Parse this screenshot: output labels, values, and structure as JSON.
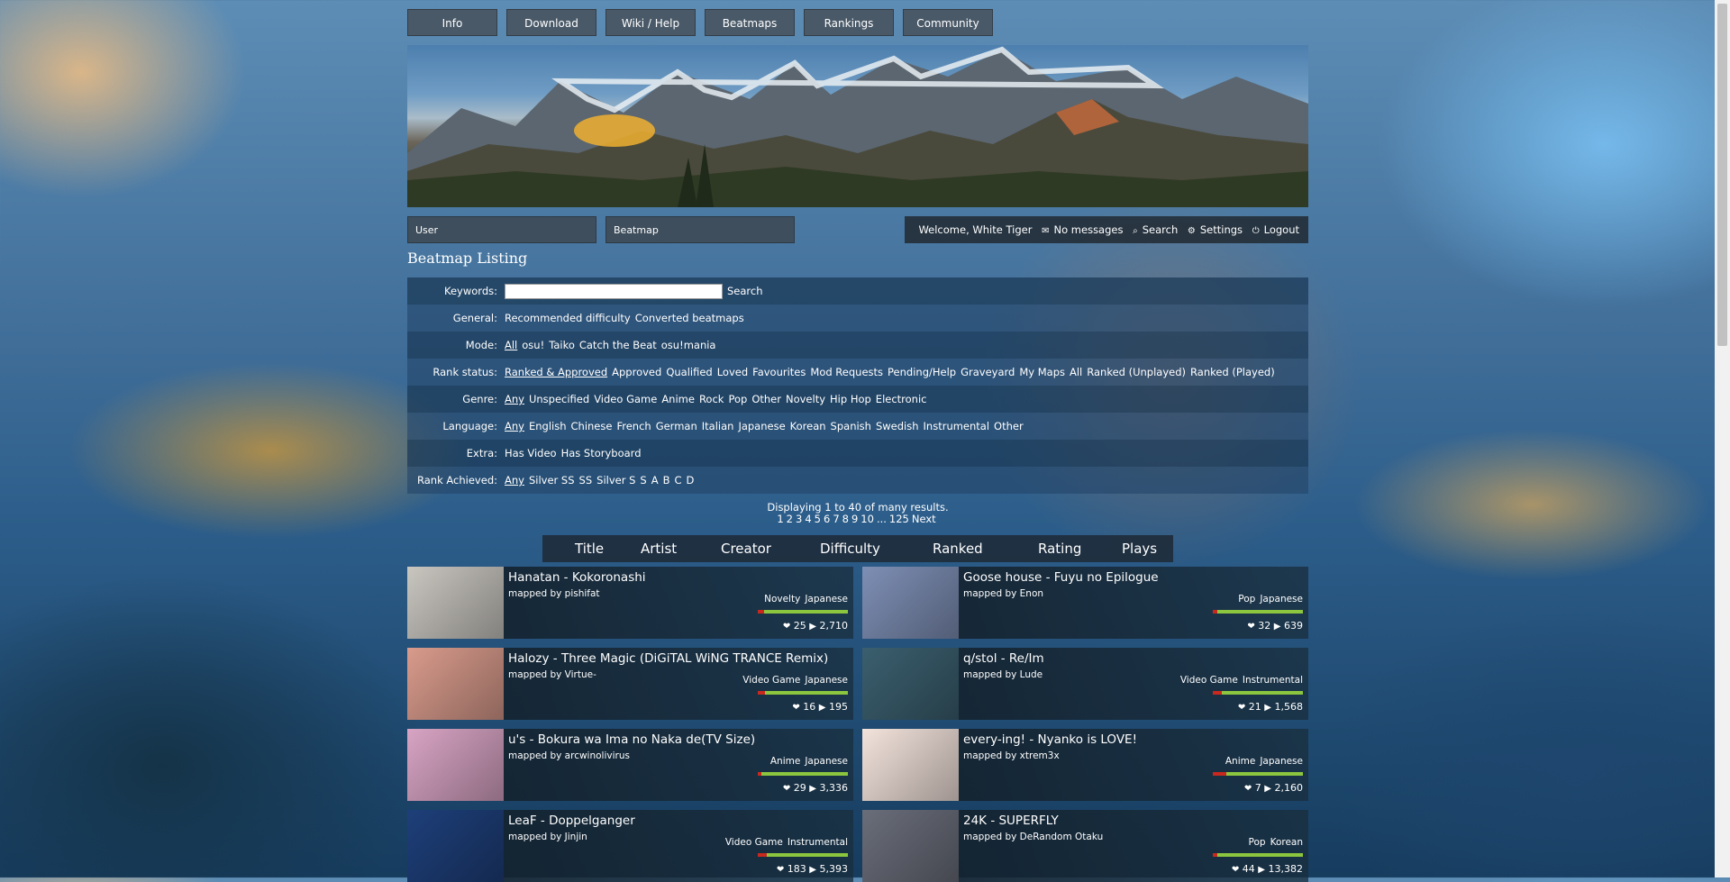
{
  "nav": [
    "Info",
    "Download",
    "Wiki / Help",
    "Beatmaps",
    "Rankings",
    "Community"
  ],
  "quicksearch": {
    "user_placeholder": "User",
    "beatmap_placeholder": "Beatmap"
  },
  "userbar": {
    "welcome": "Welcome, White Tiger",
    "messages": "No messages",
    "search": "Search",
    "settings": "Settings",
    "logout": "Logout"
  },
  "page_title": "Beatmap Listing",
  "filters": {
    "keywords": {
      "label": "Keywords:",
      "search_label": "Search"
    },
    "general": {
      "label": "General:",
      "options": [
        "Recommended difficulty",
        "Converted beatmaps"
      ]
    },
    "mode": {
      "label": "Mode:",
      "options": [
        "All",
        "osu!",
        "Taiko",
        "Catch the Beat",
        "osu!mania"
      ]
    },
    "rank_status": {
      "label": "Rank status:",
      "options": [
        "Ranked & Approved",
        "Approved",
        "Qualified",
        "Loved",
        "Favourites",
        "Mod Requests",
        "Pending/Help",
        "Graveyard",
        "My Maps",
        "All",
        "Ranked (Unplayed)",
        "Ranked (Played)"
      ]
    },
    "genre": {
      "label": "Genre:",
      "options": [
        "Any",
        "Unspecified",
        "Video Game",
        "Anime",
        "Rock",
        "Pop",
        "Other",
        "Novelty",
        "Hip Hop",
        "Electronic"
      ]
    },
    "language": {
      "label": "Language:",
      "options": [
        "Any",
        "English",
        "Chinese",
        "French",
        "German",
        "Italian",
        "Japanese",
        "Korean",
        "Spanish",
        "Swedish",
        "Instrumental",
        "Other"
      ]
    },
    "extra": {
      "label": "Extra:",
      "options": [
        "Has Video",
        "Has Storyboard"
      ]
    },
    "rank_achieved": {
      "label": "Rank Achieved:",
      "options": [
        "Any",
        "Silver SS",
        "SS",
        "Silver S",
        "S",
        "A",
        "B",
        "C",
        "D"
      ]
    }
  },
  "results": {
    "summary": "Displaying 1 to 40 of many results.",
    "pages": [
      "1",
      "2",
      "3",
      "4",
      "5",
      "6",
      "7",
      "8",
      "9",
      "10",
      "...",
      "125",
      "Next"
    ]
  },
  "sort": [
    "Title",
    "Artist",
    "Creator",
    "Difficulty",
    "Ranked",
    "Rating",
    "Plays"
  ],
  "beatmaps": [
    {
      "title": "Hanatan - Kokoronashi",
      "mapper": "mapped by pishifat",
      "genre": "Novelty",
      "language": "Japanese",
      "rating": 0.93,
      "favourites": "25",
      "plays": "2,710",
      "thumb_color": "#c9c6c0"
    },
    {
      "title": "Goose house - Fuyu no Epilogue",
      "mapper": "mapped by Enon",
      "genre": "Pop",
      "language": "Japanese",
      "rating": 0.95,
      "favourites": "32",
      "plays": "639",
      "thumb_color": "#7e8fb5"
    },
    {
      "title": "Halozy - Three Magic (DiGiTAL WiNG TRANCE Remix)",
      "mapper": "mapped by Virtue-",
      "genre": "Video Game",
      "language": "Japanese",
      "rating": 0.92,
      "favourites": "16",
      "plays": "195",
      "thumb_color": "#d99b8c"
    },
    {
      "title": "q/stol - Re/Im",
      "mapper": "mapped by Lude",
      "genre": "Video Game",
      "language": "Instrumental",
      "rating": 0.9,
      "favourites": "21",
      "plays": "1,568",
      "thumb_color": "#3b5f6f"
    },
    {
      "title": "u's - Bokura wa Ima no Naka de(TV Size)",
      "mapper": "mapped by arcwinolivirus",
      "genre": "Anime",
      "language": "Japanese",
      "rating": 0.96,
      "favourites": "29",
      "plays": "3,336",
      "thumb_color": "#d8a4c4"
    },
    {
      "title": "every-ing! - Nyanko is LOVE!",
      "mapper": "mapped by xtrem3x",
      "genre": "Anime",
      "language": "Japanese",
      "rating": 0.85,
      "favourites": "7",
      "plays": "2,160",
      "thumb_color": "#f3e3dc"
    },
    {
      "title": "LeaF - Doppelganger",
      "mapper": "mapped by Jinjin",
      "genre": "Video Game",
      "language": "Instrumental",
      "rating": 0.9,
      "favourites": "183",
      "plays": "5,393",
      "thumb_color": "#1e3f7a"
    },
    {
      "title": "24K - SUPERFLY",
      "mapper": "mapped by DeRandom Otaku",
      "genre": "Pop",
      "language": "Korean",
      "rating": 0.95,
      "favourites": "44",
      "plays": "13,382",
      "thumb_color": "#6a6e7a"
    }
  ],
  "colors": {
    "rating_good": "#8cc63f",
    "rating_bad": "#c8281e"
  }
}
